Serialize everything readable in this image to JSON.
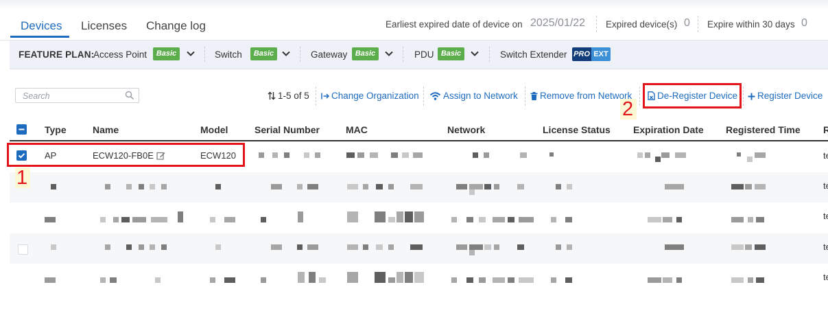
{
  "tabs": [
    {
      "label": "Devices",
      "active": true
    },
    {
      "label": "Licenses",
      "active": false
    },
    {
      "label": "Change log",
      "active": false
    }
  ],
  "summary": {
    "earliest_label": "Earliest expired date of device on",
    "earliest_value": "2025/01/22",
    "expired_label": "Expired device(s)",
    "expired_value": "0",
    "expire30_label": "Expire within 30 days",
    "expire30_value": "0"
  },
  "feature_plan": {
    "title": "FEATURE PLAN:",
    "items": [
      {
        "label": "Access Point",
        "badge": "Basic"
      },
      {
        "label": "Switch",
        "badge": "Basic"
      },
      {
        "label": "Gateway",
        "badge": "Basic"
      },
      {
        "label": "PDU",
        "badge": "Basic"
      },
      {
        "label": "Switch Extender",
        "badge_a": "PRO",
        "badge_b": "EXT"
      }
    ]
  },
  "search": {
    "placeholder": "Search"
  },
  "toolbar": {
    "count": "1-5 of 5",
    "change_org": "Change Organization",
    "assign": "Assign to Network",
    "remove": "Remove from Network",
    "deregister": "De-Register Device",
    "register": "Register Device"
  },
  "annotations": {
    "step1": "1",
    "step2": "2"
  },
  "table": {
    "headers": [
      "Type",
      "Name",
      "Model",
      "Serial Number",
      "MAC",
      "Network",
      "License Status",
      "Expiration Date",
      "Registered Time",
      "R"
    ],
    "rows": [
      {
        "type": "AP",
        "name": "ECW120-FB0E",
        "model": "ECW120",
        "last": "te",
        "selected": true
      },
      {
        "type": "",
        "name": "",
        "model": "",
        "last": "te",
        "selected": false
      },
      {
        "type": "",
        "name": "",
        "model": "",
        "last": "te",
        "selected": false
      },
      {
        "type": "",
        "name": "",
        "model": "",
        "last": "te",
        "selected": false
      },
      {
        "type": "",
        "name": "",
        "model": "",
        "last": "te",
        "selected": false
      }
    ]
  },
  "colors": {
    "accent": "#1d6bbf",
    "basic_badge": "#5cad4b",
    "highlight": "#e3151a",
    "pro_badge": "#123d7a",
    "ext_badge": "#3d8fd6"
  }
}
